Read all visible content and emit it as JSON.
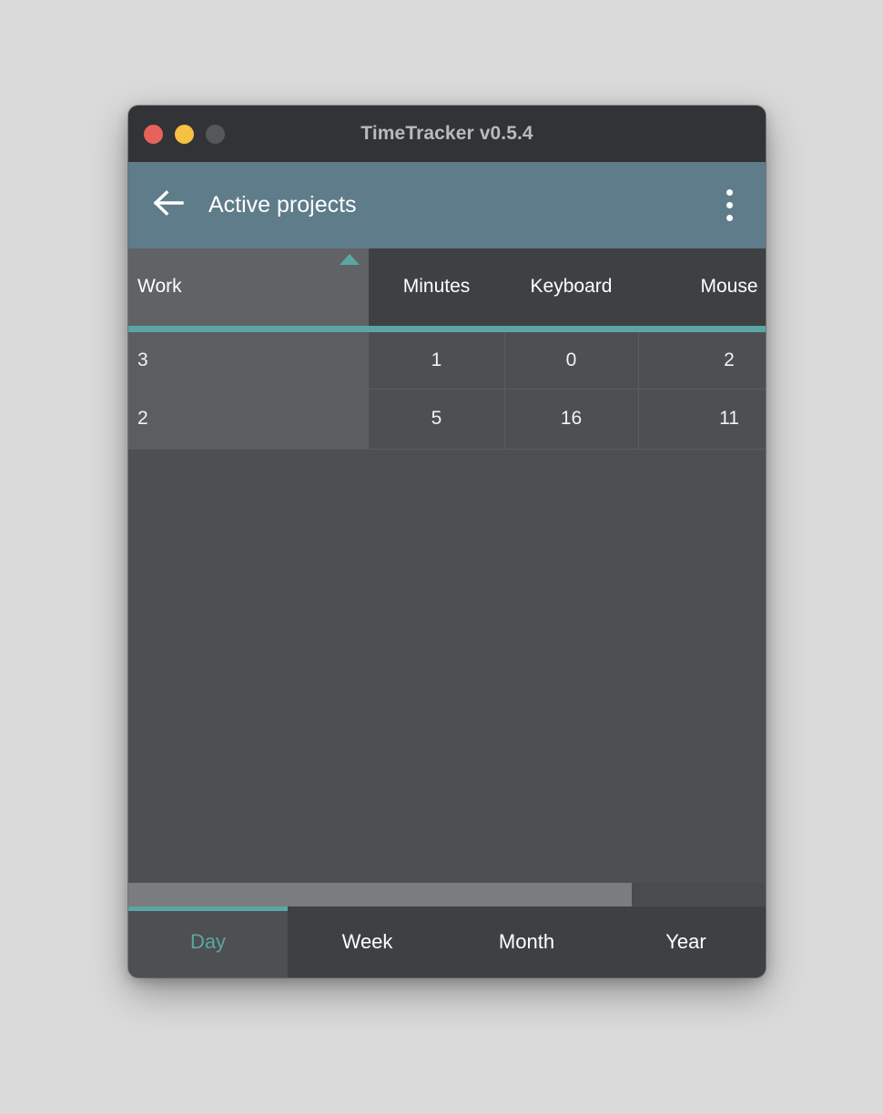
{
  "window": {
    "title": "TimeTracker v0.5.4",
    "controls": {
      "close_label": "close",
      "minimize_label": "minimize",
      "zoom_label": "zoom"
    }
  },
  "appbar": {
    "back_icon": "arrow-left-icon",
    "title": "Active projects",
    "overflow_icon": "more-vertical-icon"
  },
  "table": {
    "columns": [
      {
        "key": "work",
        "label": "Work",
        "sorted": true,
        "sort_direction": "ascending",
        "align": "left"
      },
      {
        "key": "minutes",
        "label": "Minutes",
        "sorted": false,
        "sort_direction": "",
        "align": "center"
      },
      {
        "key": "keyboard",
        "label": "Keyboard",
        "sorted": false,
        "sort_direction": "",
        "align": "center"
      },
      {
        "key": "mouse",
        "label": "Mouse",
        "sorted": false,
        "sort_direction": "",
        "align": "center"
      }
    ],
    "rows": [
      {
        "work": "3",
        "minutes": "1",
        "keyboard": "0",
        "mouse": "2"
      },
      {
        "work": "2",
        "minutes": "5",
        "keyboard": "16",
        "mouse": "11"
      }
    ]
  },
  "scrollbar": {
    "orientation": "horizontal",
    "thumb_fraction_percent": 79
  },
  "tabs": {
    "items": [
      {
        "label": "Day",
        "active": true
      },
      {
        "label": "Week",
        "active": false
      },
      {
        "label": "Month",
        "active": false
      },
      {
        "label": "Year",
        "active": false
      }
    ]
  },
  "colors": {
    "accent_teal": "#5aa6a5",
    "appbar_slate": "#5f7c8a",
    "window_body": "#4e4f51",
    "titlebar": "#323336",
    "header_row": "#3f4042",
    "sorted_column": "#616265",
    "close_red": "#e8625c",
    "minimize_yellow": "#f5c044",
    "zoom_gray": "#565759"
  }
}
